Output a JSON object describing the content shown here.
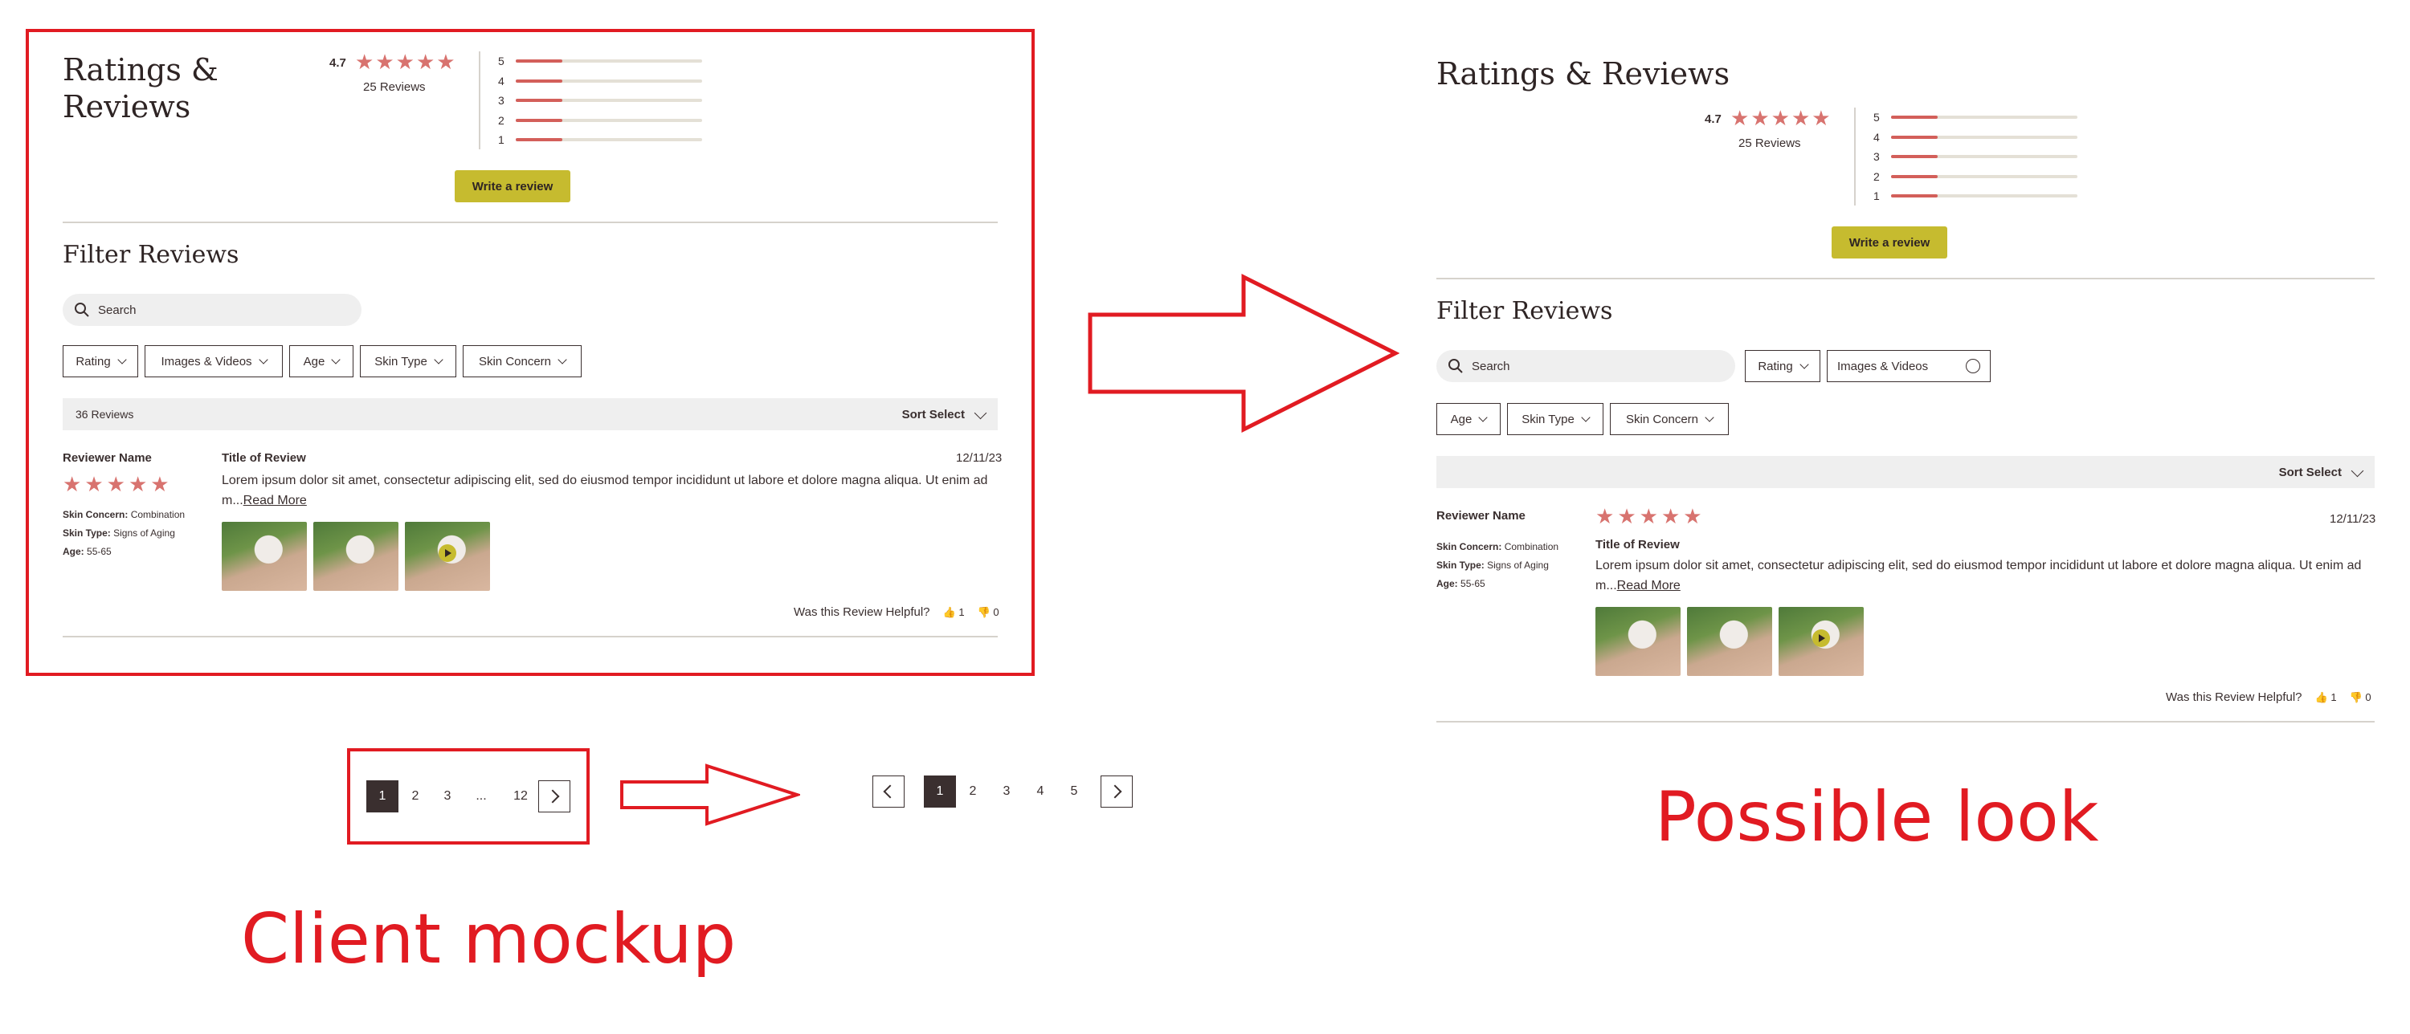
{
  "colors": {
    "accent_red": "#e11b22",
    "star": "#d8736f",
    "bar_fill": "#d35f5a",
    "button": "#c6bb2f",
    "text": "#3a2f2f"
  },
  "captions": {
    "client": "Client mockup",
    "possible": "Possible look"
  },
  "mockup": {
    "title_line1": "Ratings &",
    "title_line2": "Reviews",
    "rating": "4.7",
    "reviews_count": "25 Reviews",
    "bars": [
      {
        "label": "5",
        "fill": 0.25
      },
      {
        "label": "4",
        "fill": 0.25
      },
      {
        "label": "3",
        "fill": 0.25
      },
      {
        "label": "2",
        "fill": 0.25
      },
      {
        "label": "1",
        "fill": 0.25
      }
    ],
    "write_review": "Write a review",
    "filter_title": "Filter Reviews",
    "search_placeholder": "Search",
    "filters": [
      "Rating",
      "Images & Videos",
      "Age",
      "Skin Type",
      "Skin Concern"
    ],
    "summary": "36 Reviews",
    "sort": "Sort Select",
    "review": {
      "reviewer": "Reviewer Name",
      "concern_label": "Skin Concern:",
      "concern": "Combination",
      "type_label": "Skin Type:",
      "type": "Signs of Aging",
      "age_label": "Age:",
      "age": "55-65",
      "title": "Title of Review",
      "date": "12/11/23",
      "body": "Lorem ipsum dolor sit amet, consectetur adipiscing elit, sed do eiusmod tempor incididunt ut labore et dolore magna aliqua. Ut enim ad m...",
      "read_more": "Read More",
      "helpful": "Was this Review Helpful?",
      "up": "1",
      "down": "0"
    },
    "pagination": [
      "1",
      "2",
      "3",
      "...",
      "12"
    ]
  },
  "possible": {
    "title": "Ratings & Reviews",
    "rating": "4.7",
    "reviews_count": "25 Reviews",
    "bars": [
      {
        "label": "5",
        "fill": 0.25
      },
      {
        "label": "4",
        "fill": 0.25
      },
      {
        "label": "3",
        "fill": 0.25
      },
      {
        "label": "2",
        "fill": 0.25
      },
      {
        "label": "1",
        "fill": 0.25
      }
    ],
    "write_review": "Write a review",
    "filter_title": "Filter Reviews",
    "search_placeholder": "Search",
    "filters_row1": [
      "Rating",
      "Images & Videos"
    ],
    "filters_row2": [
      "Age",
      "Skin Type",
      "Skin Concern"
    ],
    "sort": "Sort Select",
    "review": {
      "reviewer": "Reviewer Name",
      "concern_label": "Skin Concern:",
      "concern": "Combination",
      "type_label": "Skin Type:",
      "type": "Signs of Aging",
      "age_label": "Age:",
      "age": "55-65",
      "title": "Title of Review",
      "date": "12/11/23",
      "body": "Lorem ipsum dolor sit amet, consectetur adipiscing elit, sed do eiusmod tempor incididunt ut labore et dolore magna aliqua. Ut enim ad m...",
      "read_more": "Read More",
      "helpful": "Was this Review Helpful?",
      "up": "1",
      "down": "0"
    },
    "pagination": [
      "1",
      "2",
      "3",
      "4",
      "5"
    ]
  }
}
